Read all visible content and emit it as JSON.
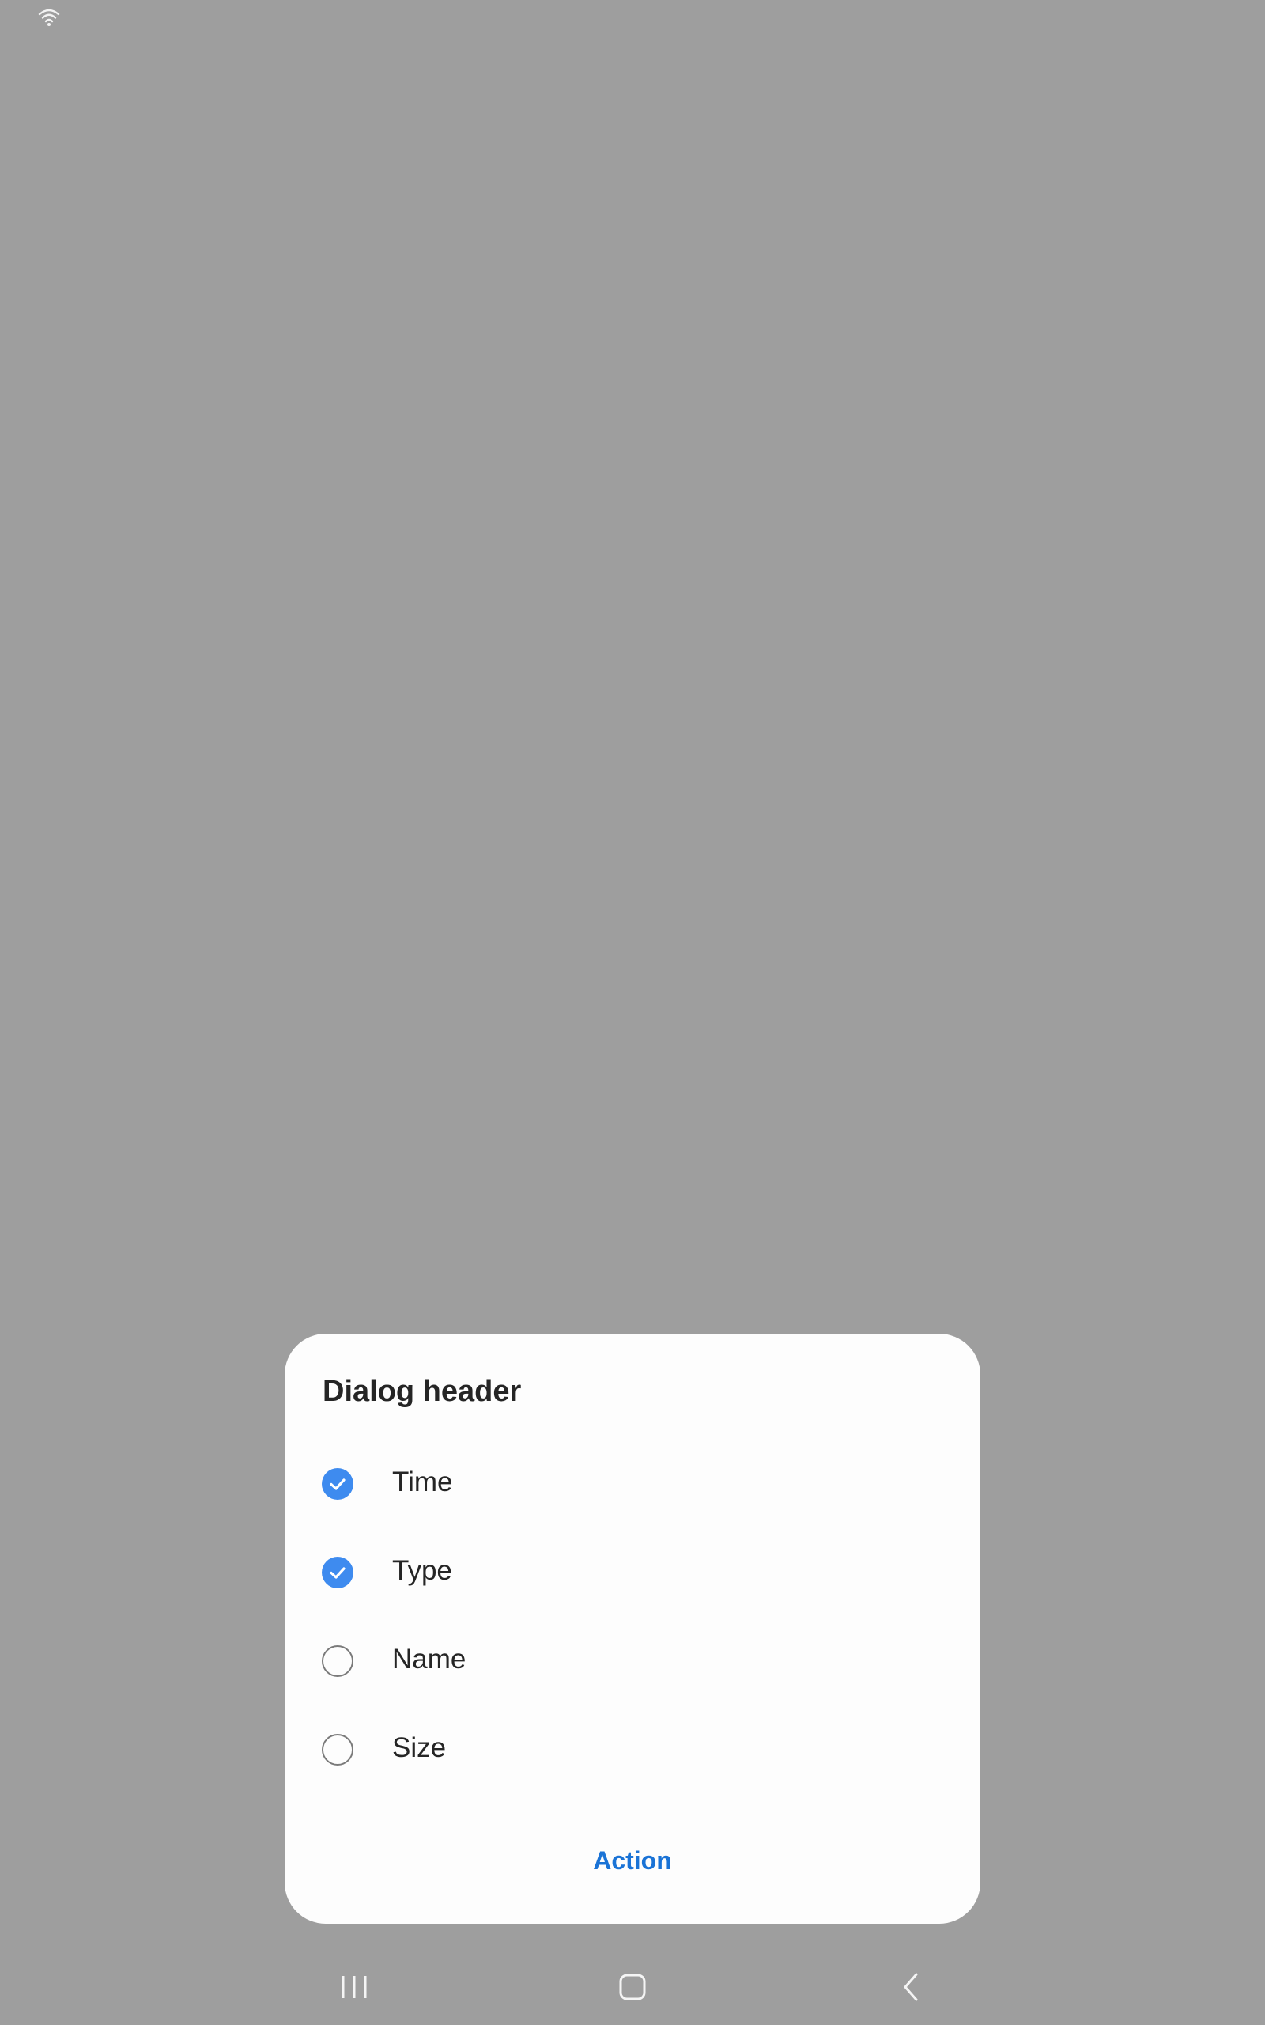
{
  "status_bar": {
    "icons": [
      "wifi-icon"
    ]
  },
  "dialog": {
    "title": "Dialog header",
    "options": [
      {
        "label": "Time",
        "checked": true
      },
      {
        "label": "Type",
        "checked": true
      },
      {
        "label": "Name",
        "checked": false
      },
      {
        "label": "Size",
        "checked": false
      }
    ],
    "action_label": "Action"
  },
  "nav_bar": {
    "icons": [
      "recent-apps-icon",
      "home-icon",
      "back-icon"
    ]
  },
  "colors": {
    "scrim": "#9e9e9e",
    "dialog_bg": "#fdfdfd",
    "checked": "#3e8bef",
    "action": "#1a73d6",
    "text": "#252525"
  }
}
